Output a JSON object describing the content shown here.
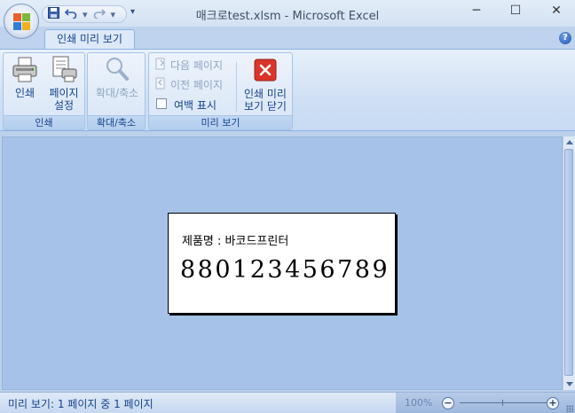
{
  "window": {
    "title": "매크로test.xlsm - Microsoft Excel",
    "minimize_glyph": "─",
    "maximize_glyph": "☐",
    "close_glyph": "✕"
  },
  "quick_access": {
    "save_icon": "save-icon",
    "undo_icon": "undo-icon",
    "redo_icon": "redo-icon",
    "more_glyph": "▾"
  },
  "tabs": [
    {
      "label": "인쇄 미리 보기",
      "active": true
    }
  ],
  "help": {
    "glyph": "?"
  },
  "ribbon": {
    "groups": [
      {
        "label": "인쇄",
        "buttons": [
          {
            "label_line1": "인쇄",
            "label_line2": "",
            "icon": "printer-icon",
            "enabled": true
          },
          {
            "label_line1": "페이지",
            "label_line2": "설정",
            "icon": "page-setup-icon",
            "enabled": true
          }
        ]
      },
      {
        "label": "확대/축소",
        "buttons": [
          {
            "label_line1": "확대/축소",
            "label_line2": "",
            "icon": "magnifier-icon",
            "enabled": false
          }
        ]
      },
      {
        "label": "미리 보기",
        "small_buttons": [
          {
            "label": "다음 페이지",
            "icon": "next-page-icon",
            "enabled": false
          },
          {
            "label": "이전 페이지",
            "icon": "previous-page-icon",
            "enabled": false
          },
          {
            "label": "여백 표시",
            "icon": "checkbox-icon",
            "enabled": true,
            "checked": false
          }
        ],
        "close_button": {
          "label_line1": "인쇄 미리",
          "label_line2": "보기 닫기",
          "icon": "close-preview-icon",
          "enabled": true
        }
      }
    ]
  },
  "preview": {
    "product_label": "제품명 : 바코드프린터",
    "barcode_number": "880123456789"
  },
  "status": {
    "text": "미리 보기: 1 페이지 중 1 페이지",
    "zoom_percent": "100%",
    "zoom_minus": "−",
    "zoom_plus": "+"
  },
  "colors": {
    "workspace": "#a6c2e8",
    "ribbon_text": "#15428b",
    "close_red": "#d9352a"
  }
}
